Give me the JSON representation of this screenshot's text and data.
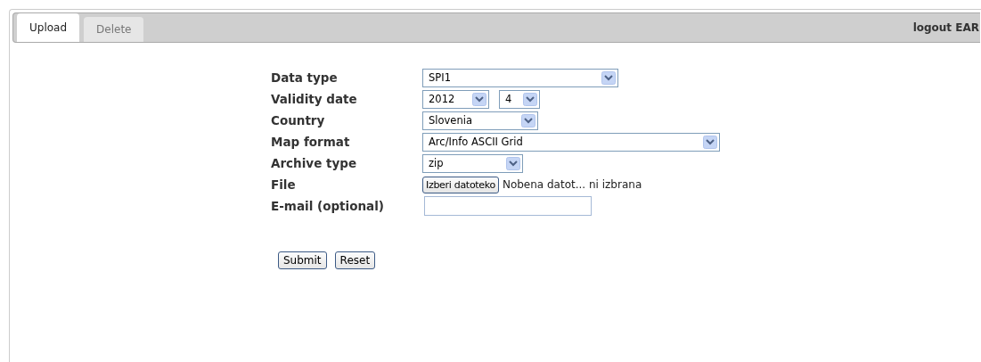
{
  "tabs": [
    {
      "label": "Upload",
      "selected": true
    },
    {
      "label": "Delete",
      "selected": false
    }
  ],
  "user_link": "logout EAR",
  "form": {
    "rows": [
      {
        "label": "Data type",
        "kind": "select",
        "values": [
          "SPI1"
        ]
      },
      {
        "label": "Validity date",
        "kind": "select",
        "values": [
          "2012",
          "4"
        ]
      },
      {
        "label": "Country",
        "kind": "select",
        "values": [
          "Slovenia"
        ]
      },
      {
        "label": "Map format",
        "kind": "select",
        "values": [
          "Arc/Info ASCII Grid"
        ]
      },
      {
        "label": "Archive type",
        "kind": "select",
        "values": [
          "zip"
        ]
      },
      {
        "label": "File",
        "kind": "file",
        "button": "Izberi datoteko",
        "status": "Nobena datot... ni izbrana"
      },
      {
        "label": "E-mail (optional)",
        "kind": "text"
      }
    ],
    "buttons": [
      "Submit",
      "Reset"
    ]
  }
}
